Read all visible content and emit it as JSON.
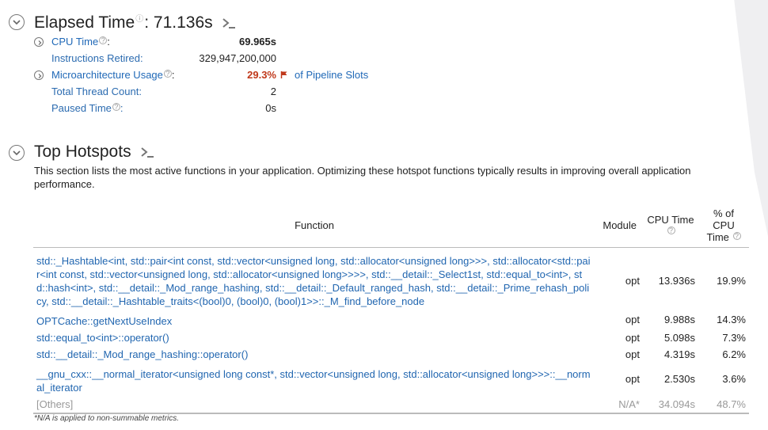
{
  "elapsed": {
    "title": "Elapsed Time",
    "colon_value": ": 71.136s",
    "metrics": [
      {
        "label": "CPU Time",
        "value": "69.965s"
      },
      {
        "label": "Instructions Retired:",
        "value": "329,947,200,000"
      },
      {
        "label": "Microarchitecture Usage",
        "value": "29.3%",
        "suffix": "of Pipeline Slots"
      },
      {
        "label": "Total Thread Count:",
        "value": "2"
      },
      {
        "label": "Paused Time",
        "value": "0s"
      }
    ]
  },
  "hotspots": {
    "title": "Top Hotspots",
    "description": "This section lists the most active functions in your application. Optimizing these hotspot functions typically results in improving overall application performance.",
    "columns": [
      "Function",
      "Module",
      "CPU Time",
      "% of CPU Time"
    ],
    "rows": [
      {
        "function": "std::_Hashtable<int, std::pair<int const, std::vector<unsigned long, std::allocator<unsigned long>>>, std::allocator<std::pair<int const, std::vector<unsigned long, std::allocator<unsigned long>>>>, std::__detail::_Select1st, std::equal_to<int>, std::hash<int>, std::__detail::_Mod_range_hashing, std::__detail::_Default_ranged_hash, std::__detail::_Prime_rehash_policy, std::__detail::_Hashtable_traits<(bool)0, (bool)0, (bool)1>>::_M_find_before_node",
        "module": "opt",
        "cpu": "13.936s",
        "pct": "19.9%"
      },
      {
        "function": "OPTCache::getNextUseIndex",
        "module": "opt",
        "cpu": "9.988s",
        "pct": "14.3%"
      },
      {
        "function": "std::equal_to<int>::operator()",
        "module": "opt",
        "cpu": "5.098s",
        "pct": "7.3%"
      },
      {
        "function": "std::__detail::_Mod_range_hashing::operator()",
        "module": "opt",
        "cpu": "4.319s",
        "pct": "6.2%"
      },
      {
        "function": "__gnu_cxx::__normal_iterator<unsigned long const*, std::vector<unsigned long, std::allocator<unsigned long>>>::__normal_iterator",
        "module": "opt",
        "cpu": "2.530s",
        "pct": "3.6%"
      },
      {
        "function": "[Others]",
        "module": "N/A*",
        "cpu": "34.094s",
        "pct": "48.7%"
      }
    ],
    "footnote": "*N/A is applied to non-summable metrics."
  },
  "colors": {
    "link": "#2166b0",
    "warning": "#c0391b",
    "muted": "#999999"
  }
}
